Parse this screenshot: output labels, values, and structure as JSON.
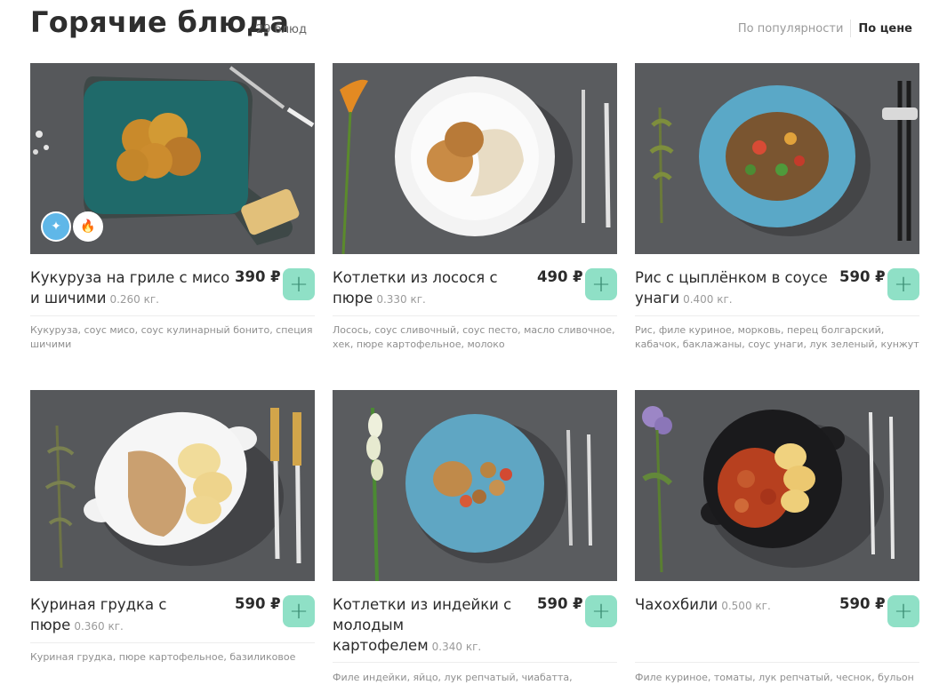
{
  "header": {
    "title": "Горячие блюда",
    "count": "29 блюд"
  },
  "sort": {
    "options": [
      "По популярности",
      "По цене"
    ],
    "active_index": 1
  },
  "currency": "₽",
  "badge_icons": [
    "sparkle-icon",
    "fire-icon"
  ],
  "colors": {
    "accent": "#8fe0c6",
    "accent_dark": "#3a8c72",
    "vegan_badge": "#5fb7e8",
    "spicy_badge": "#e26a4a"
  },
  "dishes": [
    {
      "name": "Кукуруза на гриле с мисо и шичими",
      "weight": "0.260 кг.",
      "price": "390 ₽",
      "ingredients": "Кукуруза, соус мисо, соус кулинарный бонито, специя шичими",
      "plate": "teal board with grilled corn",
      "badges": [
        "vegan",
        "spicy"
      ]
    },
    {
      "name": "Котлетки из лосося с пюре",
      "weight": "0.330 кг.",
      "price": "490 ₽",
      "ingredients": "Лосось, соус сливочный, соус песто, масло сливочное, хек, пюре картофельное, молоко",
      "plate": "white plate"
    },
    {
      "name": "Рис с цыплёнком в соусе унаги",
      "weight": "0.400 кг.",
      "price": "590 ₽",
      "ingredients": "Рис, филе куриное, морковь, перец болгарский, кабачок, баклажаны, соус унаги, лук зеленый, кунжут",
      "plate": "blue bowl"
    },
    {
      "name": "Куриная грудка с пюре",
      "weight": "0.360 кг.",
      "price": "590 ₽",
      "ingredients": "Куриная грудка, пюре картофельное, базиликовое",
      "plate": "white dish with handles"
    },
    {
      "name": "Котлетки из индейки с молодым картофелем",
      "weight": "0.340 кг.",
      "price": "590 ₽",
      "ingredients": "Филе индейки, яйцо, лук репчатый, чиабатта,",
      "plate": "blue plate"
    },
    {
      "name": "Чахохбили",
      "weight": "0.500 кг.",
      "price": "590 ₽",
      "ingredients": "Филе куриное, томаты, лук репчатый, чеснок, бульон",
      "plate": "black pan"
    }
  ]
}
